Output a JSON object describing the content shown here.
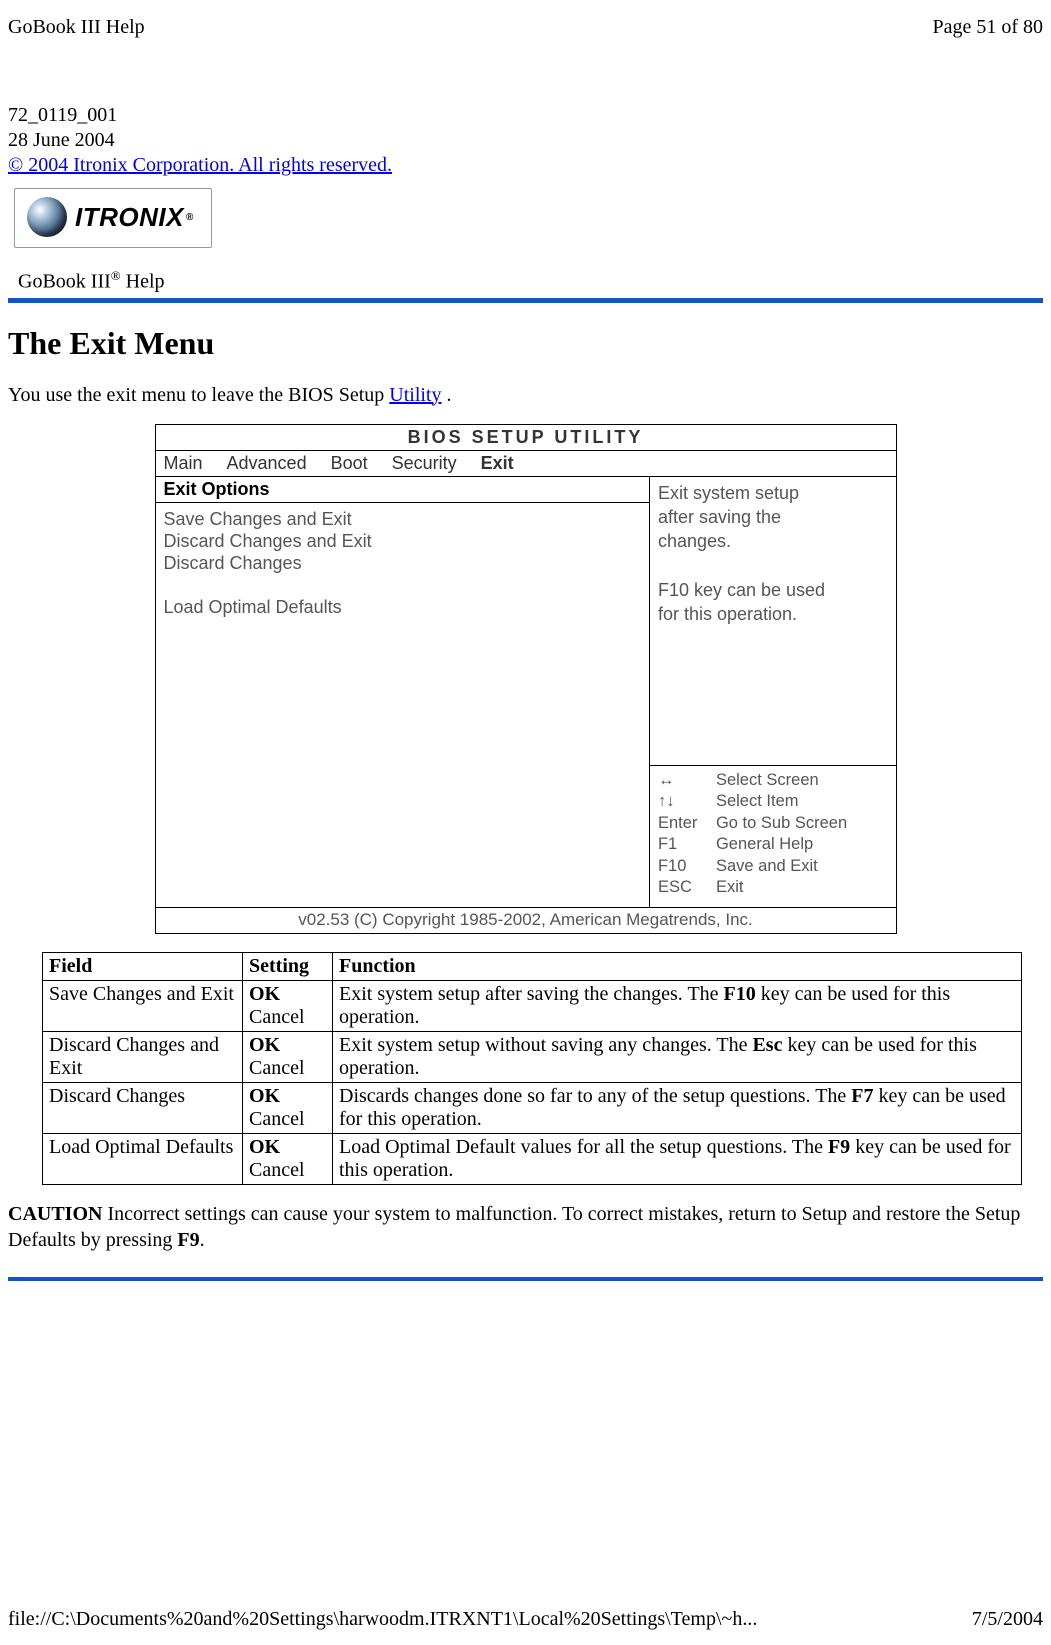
{
  "header": {
    "left": "GoBook III Help",
    "right": "Page 51 of 80"
  },
  "pre": {
    "doc_id": "72_0119_001",
    "date": "28 June 2004",
    "copyright_link": "© 2004 Itronix Corporation.  All rights reserved."
  },
  "brand": {
    "word": "ITRONIX",
    "trade": "®"
  },
  "product_line": {
    "prefix": "GoBook III",
    "sup": "®",
    "suffix": " Help"
  },
  "section_title": "The Exit Menu",
  "intro": {
    "before_link": "You use the exit menu to leave the BIOS Setup ",
    "link": "Utility",
    "after_link": " ."
  },
  "bios": {
    "title": "BIOS   SETUP   UTILITY",
    "tabs": [
      "Main",
      "Advanced",
      "Boot",
      "Security",
      "Exit"
    ],
    "active_tab_index": 4,
    "left": {
      "title": "Exit Options",
      "items": [
        "Save Changes and Exit",
        "Discard Changes and Exit",
        "Discard Changes",
        "",
        "Load Optimal Defaults"
      ]
    },
    "right": {
      "help_top": [
        "Exit system setup",
        "after saving the",
        "changes.",
        "",
        "F10 key can be used",
        "for this operation."
      ],
      "keys": [
        {
          "k": "↔",
          "v": "Select Screen"
        },
        {
          "k": "↑↓",
          "v": "Select Item"
        },
        {
          "k": "Enter",
          "v": "Go to Sub Screen"
        },
        {
          "k": "F1",
          "v": "General Help"
        },
        {
          "k": "F10",
          "v": "Save and Exit"
        },
        {
          "k": "ESC",
          "v": "Exit"
        }
      ]
    },
    "footer": "v02.53 (C) Copyright 1985-2002, American Megatrends, Inc."
  },
  "table": {
    "headers": [
      "Field",
      "Setting",
      "Function"
    ],
    "rows": [
      {
        "field": "Save Changes and Exit",
        "setting_bold": "OK",
        "setting_rest": "Cancel",
        "fn_pre": "Exit system setup after saving the changes. The ",
        "fn_bold": "F10",
        "fn_post": " key can be used for this operation."
      },
      {
        "field": "Discard Changes and Exit",
        "setting_bold": "OK",
        "setting_rest": "Cancel",
        "fn_pre": "Exit system setup without saving any changes. The ",
        "fn_bold": "Esc",
        "fn_post": " key can be used for this operation."
      },
      {
        "field": "Discard Changes",
        "setting_bold": "OK",
        "setting_rest": "Cancel",
        "fn_pre": "Discards changes done so far to any of the setup questions. The ",
        "fn_bold": "F7",
        "fn_post": " key can be used for this operation."
      },
      {
        "field": "Load Optimal Defaults",
        "setting_bold": "OK",
        "setting_rest": "Cancel",
        "fn_pre": "Load Optimal Default values for all the setup questions. The ",
        "fn_bold": "F9",
        "fn_post": " key can be used for this operation."
      }
    ]
  },
  "caution": {
    "label": "CAUTION",
    "text_pre": "  Incorrect settings can cause your system to malfunction. To correct mistakes, return to Setup and restore the Setup Defaults by pressing ",
    "bold": "F9",
    "text_post": "."
  },
  "footer": {
    "left": "file://C:\\Documents%20and%20Settings\\harwoodm.ITRXNT1\\Local%20Settings\\Temp\\~h...",
    "right": "7/5/2004"
  }
}
